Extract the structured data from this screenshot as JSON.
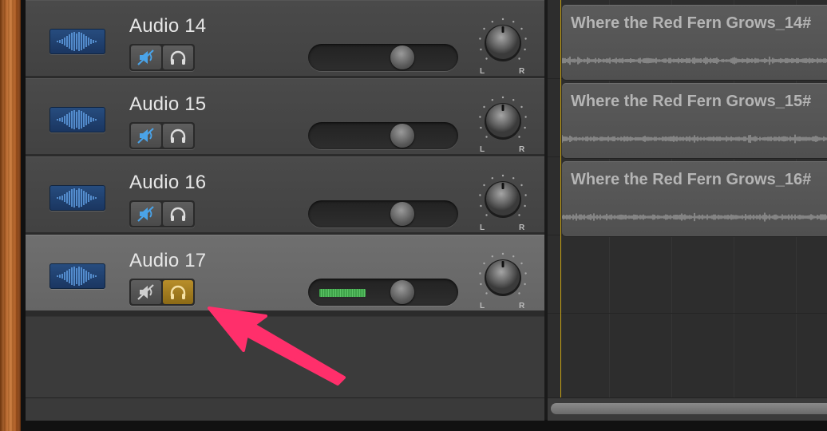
{
  "tracks": [
    {
      "name": "Audio 14",
      "muted": true,
      "solo": false,
      "volume": 0.62,
      "meter": 0,
      "selected": false
    },
    {
      "name": "Audio 15",
      "muted": true,
      "solo": false,
      "volume": 0.62,
      "meter": 0,
      "selected": false
    },
    {
      "name": "Audio 16",
      "muted": true,
      "solo": false,
      "volume": 0.62,
      "meter": 0,
      "selected": false
    },
    {
      "name": "Audio 17",
      "muted": false,
      "solo": true,
      "volume": 0.62,
      "meter": 0.36,
      "selected": true
    }
  ],
  "pan": {
    "left_label": "L",
    "right_label": "R"
  },
  "regions": [
    {
      "name": "Where the Red Fern Grows_14#"
    },
    {
      "name": "Where the Red Fern Grows_15#"
    },
    {
      "name": "Where the Red Fern Grows_16#"
    }
  ],
  "icons": {
    "track": "audio-waveform-icon",
    "mute": "speaker-muted-icon",
    "solo": "headphones-icon",
    "pan": "pan-knob-icon"
  },
  "colors": {
    "track_icon": "#274d80",
    "mute_active": "#4aa3e8",
    "solo_active": "#b88e2a",
    "meter": "#3fa24a",
    "playhead": "#c9a415",
    "annotation_arrow": "#ff2f6b"
  }
}
